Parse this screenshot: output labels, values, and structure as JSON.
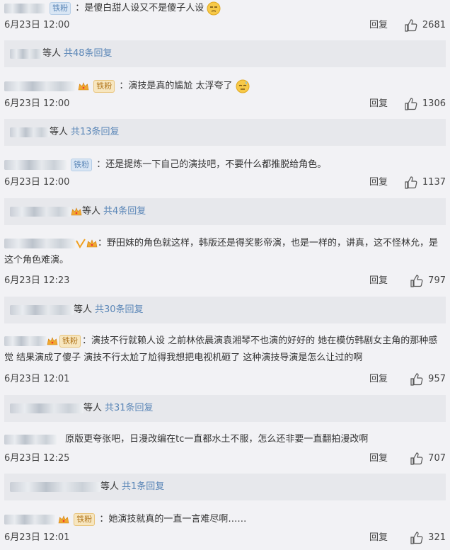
{
  "comments": [
    {
      "badge": "铁粉",
      "text": "：是傻白甜人设又不是傻子人设",
      "emoji": "smirk-emoji",
      "date": "6月23日 12:00",
      "reply": "回复",
      "likes": "2681",
      "sub_label": "等人",
      "sub_count": "共48条回复"
    },
    {
      "badge": "铁粉",
      "text": "：演技是真的尴尬 太浮夸了",
      "emoji": "sweat-emoji",
      "date": "6月23日 12:00",
      "reply": "回复",
      "likes": "1306",
      "sub_label": "等人",
      "sub_count": "共13条回复"
    },
    {
      "badge": "铁粉",
      "text": "：还是提炼一下自己的演技吧，不要什么都推脱给角色。",
      "date": "6月23日 12:00",
      "reply": "回复",
      "likes": "1137",
      "sub_label": "等人",
      "sub_count": "共4条回复"
    },
    {
      "text": "：野田妹的角色就这样，韩版还是得奖影帝演，也是一样的，讲真，这不怪林允，是这个角色难演。",
      "date": "6月23日 12:23",
      "reply": "回复",
      "likes": "797",
      "sub_label": "等人",
      "sub_count": "共30条回复"
    },
    {
      "badge": "铁粉",
      "text": "：演技不行就赖人设 之前林依晨演袁湘琴不也演的好好的 她在模仿韩剧女主角的那种感觉 结果演成了傻子 演技不行太尬了尬得我想把电视机砸了 这种演技导演是怎么让过的啊",
      "date": "6月23日 12:01",
      "reply": "回复",
      "likes": "957",
      "sub_label": "等人",
      "sub_count": "共31条回复"
    },
    {
      "text": "原版更夸张吧，日漫改编在tc一直都水土不服，怎么还非要一直翻拍漫改啊",
      "date": "6月23日 12:25",
      "reply": "回复",
      "likes": "707",
      "sub_label": "等人",
      "sub_count": "共1条回复"
    },
    {
      "badge": "铁粉",
      "text": "：她演技就真的一直一言难尽啊……",
      "date": "6月23日 12:01",
      "reply": "回复",
      "likes": "321"
    }
  ],
  "colors": {
    "link": "#5a86b7",
    "background": "#f2f2f5",
    "sub_background": "#e7e8ec"
  }
}
